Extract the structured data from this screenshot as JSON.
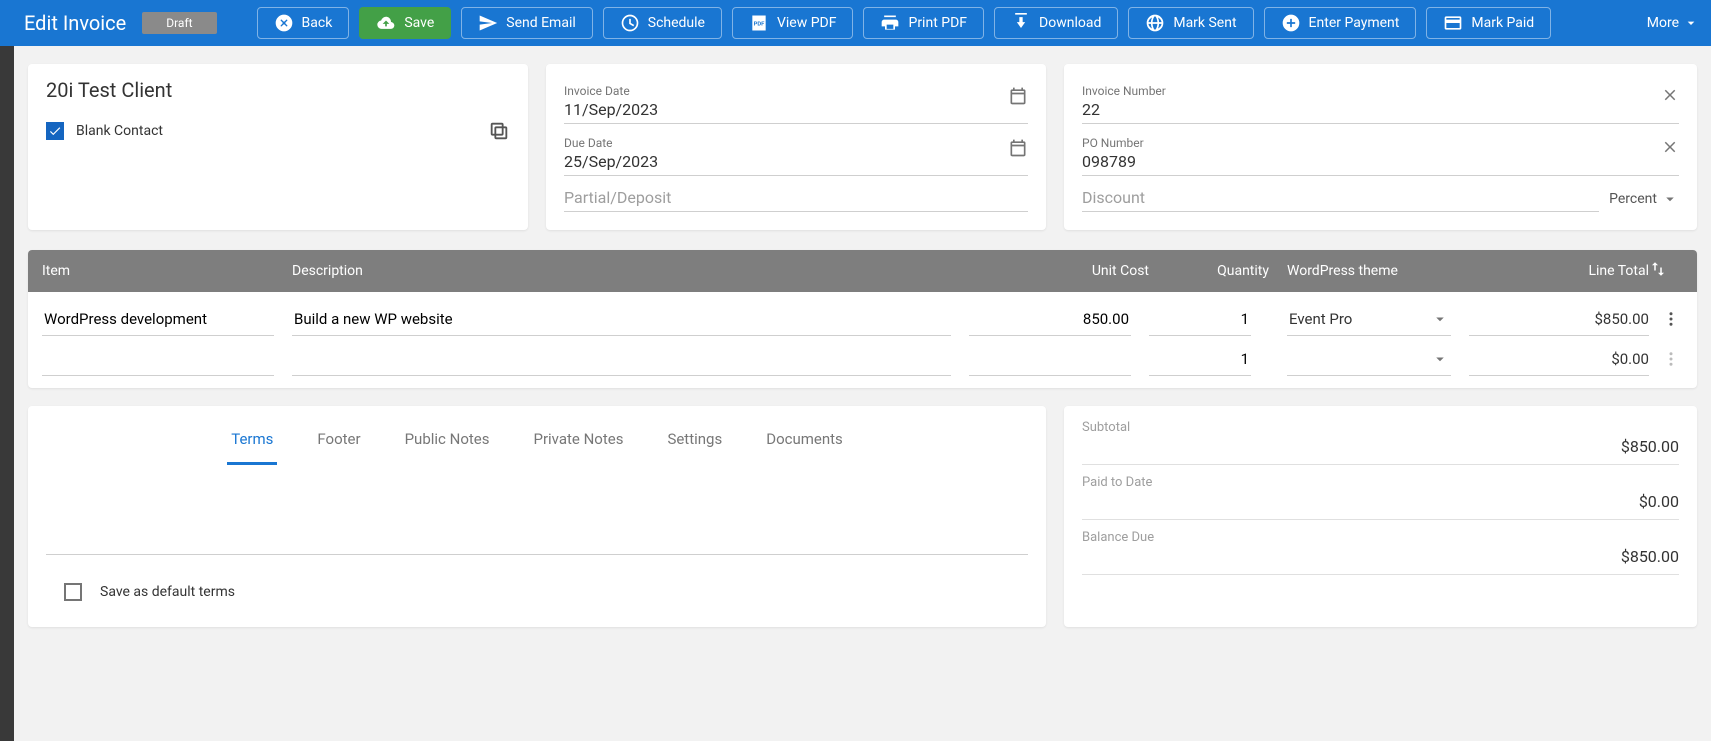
{
  "header": {
    "title": "Edit Invoice",
    "status": "Draft",
    "buttons": {
      "back": "Back",
      "save": "Save",
      "send_email": "Send Email",
      "schedule": "Schedule",
      "view_pdf": "View PDF",
      "print_pdf": "Print PDF",
      "download": "Download",
      "mark_sent": "Mark Sent",
      "enter_payment": "Enter Payment",
      "mark_paid": "Mark Paid"
    },
    "more": "More"
  },
  "client": {
    "name": "20i Test Client",
    "contact": "Blank Contact"
  },
  "dates": {
    "invoice_date_label": "Invoice Date",
    "invoice_date": "11/Sep/2023",
    "due_date_label": "Due Date",
    "due_date": "25/Sep/2023",
    "partial_label": "Partial/Deposit"
  },
  "meta": {
    "invoice_number_label": "Invoice Number",
    "invoice_number": "22",
    "po_number_label": "PO Number",
    "po_number": "098789",
    "discount_label": "Discount",
    "discount_type": "Percent"
  },
  "items": {
    "headers": {
      "item": "Item",
      "description": "Description",
      "unit_cost": "Unit Cost",
      "quantity": "Quantity",
      "theme": "WordPress theme",
      "line_total": "Line Total"
    },
    "rows": [
      {
        "item": "WordPress development",
        "description": "Build a new WP website",
        "unit_cost": "850.00",
        "quantity": "1",
        "theme": "Event Pro",
        "line_total": "$850.00"
      },
      {
        "item": "",
        "description": "",
        "unit_cost": "",
        "quantity": "1",
        "theme": "",
        "line_total": "$0.00"
      }
    ]
  },
  "tabs": {
    "terms": "Terms",
    "footer": "Footer",
    "public_notes": "Public Notes",
    "private_notes": "Private Notes",
    "settings": "Settings",
    "documents": "Documents",
    "save_default": "Save as default terms"
  },
  "totals": {
    "subtotal_label": "Subtotal",
    "subtotal": "$850.00",
    "paid_label": "Paid to Date",
    "paid": "$0.00",
    "balance_label": "Balance Due",
    "balance": "$850.00"
  }
}
